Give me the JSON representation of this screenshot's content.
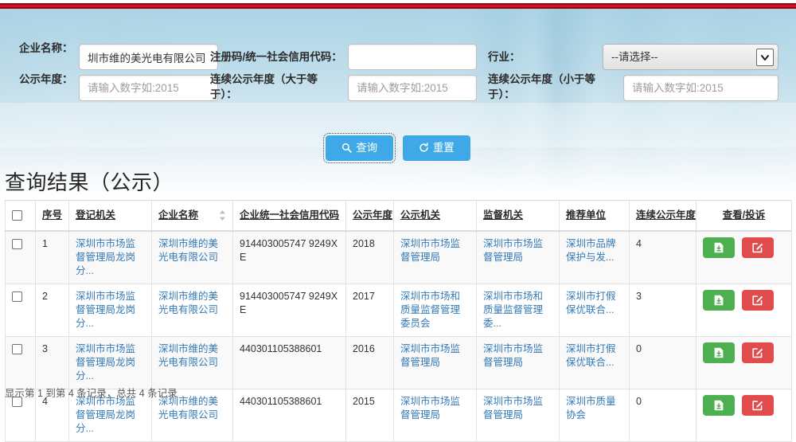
{
  "theme": {
    "top_rule_color": "#cf1122",
    "primary_button_color": "#3fa9e8",
    "link_color": "#337ab7",
    "view_button_color": "#4caf50",
    "complaint_button_color": "#e14b4b"
  },
  "search": {
    "fields": [
      {
        "label": "企业名称：",
        "type": "text",
        "value": "圳市维的美光电有限公司",
        "placeholder": ""
      },
      {
        "label": "注册码/统一社会信用代码：",
        "type": "text",
        "value": "",
        "placeholder": ""
      },
      {
        "label": "行业：",
        "type": "select",
        "value": "--请选择--",
        "options": [
          "--请选择--"
        ]
      },
      {
        "label": "公示年度：",
        "type": "text",
        "value": "",
        "placeholder": "请输入数字如:2015"
      },
      {
        "label": "连续公示年度（大于等于）：",
        "type": "text",
        "value": "",
        "placeholder": "请输入数字如:2015"
      },
      {
        "label": "连续公示年度（小于等于）：",
        "type": "text",
        "value": "",
        "placeholder": "请输入数字如:2015"
      }
    ],
    "buttons": {
      "query_label": "查询",
      "query_icon": "search-icon",
      "reset_label": "重置",
      "reset_icon": "refresh-icon"
    }
  },
  "results": {
    "title": "查询结果（公示）",
    "columns": [
      {
        "label": "",
        "name": "select-all",
        "sortable": false
      },
      {
        "label": "序号",
        "name": "index",
        "sortable": false
      },
      {
        "label": "登记机关",
        "name": "registration-authority",
        "sortable": false
      },
      {
        "label": "企业名称",
        "name": "enterprise-name",
        "sortable": true
      },
      {
        "label": "企业统一社会信用代码",
        "name": "credit-code",
        "sortable": false
      },
      {
        "label": "公示年度",
        "name": "publicity-year",
        "sortable": false
      },
      {
        "label": "公示机关",
        "name": "publicity-authority",
        "sortable": false
      },
      {
        "label": "监督机关",
        "name": "supervisory-authority",
        "sortable": false
      },
      {
        "label": "推荐单位",
        "name": "recommending-unit",
        "sortable": false
      },
      {
        "label": "连续公示年度",
        "name": "consecutive-years",
        "sortable": false
      },
      {
        "label": "查看/投诉",
        "name": "actions",
        "sortable": false
      }
    ],
    "rows": [
      {
        "index": "1",
        "registration_authority": "深圳市市场监督管理局龙岗分...",
        "enterprise_name": "深圳市维的美光电有限公司",
        "credit_code": "914403005747 9249XE",
        "publicity_year": "2018",
        "publicity_authority": "深圳市市场监督管理局",
        "supervisory_authority": "深圳市市场监督管理局",
        "recommending_unit": "深圳市品牌保护与发...",
        "consecutive_years": "4",
        "view_label": "",
        "complaint_label": ""
      },
      {
        "index": "2",
        "registration_authority": "深圳市市场监督管理局龙岗分...",
        "enterprise_name": "深圳市维的美光电有限公司",
        "credit_code": "914403005747 9249XE",
        "publicity_year": "2017",
        "publicity_authority": "深圳市市场和质量监督管理委员会",
        "supervisory_authority": "深圳市市场和质量监督管理委...",
        "recommending_unit": "深圳市打假保优联合...",
        "consecutive_years": "3",
        "view_label": "",
        "complaint_label": ""
      },
      {
        "index": "3",
        "registration_authority": "深圳市市场监督管理局龙岗分...",
        "enterprise_name": "深圳市维的美光电有限公司",
        "credit_code": "440301105388601",
        "publicity_year": "2016",
        "publicity_authority": "深圳市市场监督管理局",
        "supervisory_authority": "深圳市市场监督管理局",
        "recommending_unit": "深圳市打假保优联合...",
        "consecutive_years": "0",
        "view_label": "",
        "complaint_label": ""
      },
      {
        "index": "4",
        "registration_authority": "深圳市市场监督管理局龙岗分...",
        "enterprise_name": "深圳市维的美光电有限公司",
        "credit_code": "440301105388601",
        "publicity_year": "2015",
        "publicity_authority": "深圳市市场监督管理局",
        "supervisory_authority": "深圳市市场监督管理局",
        "recommending_unit": "深圳市质量协会",
        "consecutive_years": "0",
        "view_label": "",
        "complaint_label": ""
      }
    ],
    "info_text": "显示第 1 到第 4 条记录，总共 4 条记录",
    "action_icons": {
      "view": "file-download-icon",
      "complaint": "edit-pencil-icon"
    }
  }
}
